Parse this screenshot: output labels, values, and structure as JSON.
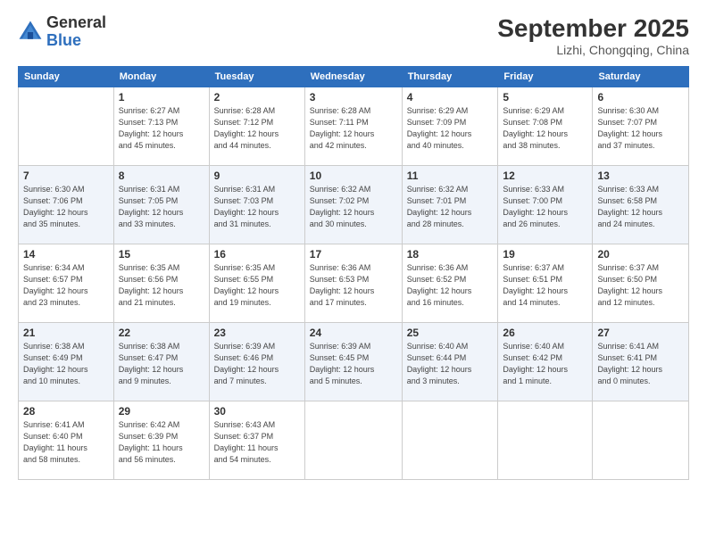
{
  "header": {
    "logo": {
      "general": "General",
      "blue": "Blue"
    },
    "title": "September 2025",
    "location": "Lizhi, Chongqing, China"
  },
  "days_of_week": [
    "Sunday",
    "Monday",
    "Tuesday",
    "Wednesday",
    "Thursday",
    "Friday",
    "Saturday"
  ],
  "weeks": [
    [
      {
        "day": "",
        "info": ""
      },
      {
        "day": "1",
        "info": "Sunrise: 6:27 AM\nSunset: 7:13 PM\nDaylight: 12 hours\nand 45 minutes."
      },
      {
        "day": "2",
        "info": "Sunrise: 6:28 AM\nSunset: 7:12 PM\nDaylight: 12 hours\nand 44 minutes."
      },
      {
        "day": "3",
        "info": "Sunrise: 6:28 AM\nSunset: 7:11 PM\nDaylight: 12 hours\nand 42 minutes."
      },
      {
        "day": "4",
        "info": "Sunrise: 6:29 AM\nSunset: 7:09 PM\nDaylight: 12 hours\nand 40 minutes."
      },
      {
        "day": "5",
        "info": "Sunrise: 6:29 AM\nSunset: 7:08 PM\nDaylight: 12 hours\nand 38 minutes."
      },
      {
        "day": "6",
        "info": "Sunrise: 6:30 AM\nSunset: 7:07 PM\nDaylight: 12 hours\nand 37 minutes."
      }
    ],
    [
      {
        "day": "7",
        "info": "Sunrise: 6:30 AM\nSunset: 7:06 PM\nDaylight: 12 hours\nand 35 minutes."
      },
      {
        "day": "8",
        "info": "Sunrise: 6:31 AM\nSunset: 7:05 PM\nDaylight: 12 hours\nand 33 minutes."
      },
      {
        "day": "9",
        "info": "Sunrise: 6:31 AM\nSunset: 7:03 PM\nDaylight: 12 hours\nand 31 minutes."
      },
      {
        "day": "10",
        "info": "Sunrise: 6:32 AM\nSunset: 7:02 PM\nDaylight: 12 hours\nand 30 minutes."
      },
      {
        "day": "11",
        "info": "Sunrise: 6:32 AM\nSunset: 7:01 PM\nDaylight: 12 hours\nand 28 minutes."
      },
      {
        "day": "12",
        "info": "Sunrise: 6:33 AM\nSunset: 7:00 PM\nDaylight: 12 hours\nand 26 minutes."
      },
      {
        "day": "13",
        "info": "Sunrise: 6:33 AM\nSunset: 6:58 PM\nDaylight: 12 hours\nand 24 minutes."
      }
    ],
    [
      {
        "day": "14",
        "info": "Sunrise: 6:34 AM\nSunset: 6:57 PM\nDaylight: 12 hours\nand 23 minutes."
      },
      {
        "day": "15",
        "info": "Sunrise: 6:35 AM\nSunset: 6:56 PM\nDaylight: 12 hours\nand 21 minutes."
      },
      {
        "day": "16",
        "info": "Sunrise: 6:35 AM\nSunset: 6:55 PM\nDaylight: 12 hours\nand 19 minutes."
      },
      {
        "day": "17",
        "info": "Sunrise: 6:36 AM\nSunset: 6:53 PM\nDaylight: 12 hours\nand 17 minutes."
      },
      {
        "day": "18",
        "info": "Sunrise: 6:36 AM\nSunset: 6:52 PM\nDaylight: 12 hours\nand 16 minutes."
      },
      {
        "day": "19",
        "info": "Sunrise: 6:37 AM\nSunset: 6:51 PM\nDaylight: 12 hours\nand 14 minutes."
      },
      {
        "day": "20",
        "info": "Sunrise: 6:37 AM\nSunset: 6:50 PM\nDaylight: 12 hours\nand 12 minutes."
      }
    ],
    [
      {
        "day": "21",
        "info": "Sunrise: 6:38 AM\nSunset: 6:49 PM\nDaylight: 12 hours\nand 10 minutes."
      },
      {
        "day": "22",
        "info": "Sunrise: 6:38 AM\nSunset: 6:47 PM\nDaylight: 12 hours\nand 9 minutes."
      },
      {
        "day": "23",
        "info": "Sunrise: 6:39 AM\nSunset: 6:46 PM\nDaylight: 12 hours\nand 7 minutes."
      },
      {
        "day": "24",
        "info": "Sunrise: 6:39 AM\nSunset: 6:45 PM\nDaylight: 12 hours\nand 5 minutes."
      },
      {
        "day": "25",
        "info": "Sunrise: 6:40 AM\nSunset: 6:44 PM\nDaylight: 12 hours\nand 3 minutes."
      },
      {
        "day": "26",
        "info": "Sunrise: 6:40 AM\nSunset: 6:42 PM\nDaylight: 12 hours\nand 1 minute."
      },
      {
        "day": "27",
        "info": "Sunrise: 6:41 AM\nSunset: 6:41 PM\nDaylight: 12 hours\nand 0 minutes."
      }
    ],
    [
      {
        "day": "28",
        "info": "Sunrise: 6:41 AM\nSunset: 6:40 PM\nDaylight: 11 hours\nand 58 minutes."
      },
      {
        "day": "29",
        "info": "Sunrise: 6:42 AM\nSunset: 6:39 PM\nDaylight: 11 hours\nand 56 minutes."
      },
      {
        "day": "30",
        "info": "Sunrise: 6:43 AM\nSunset: 6:37 PM\nDaylight: 11 hours\nand 54 minutes."
      },
      {
        "day": "",
        "info": ""
      },
      {
        "day": "",
        "info": ""
      },
      {
        "day": "",
        "info": ""
      },
      {
        "day": "",
        "info": ""
      }
    ]
  ]
}
